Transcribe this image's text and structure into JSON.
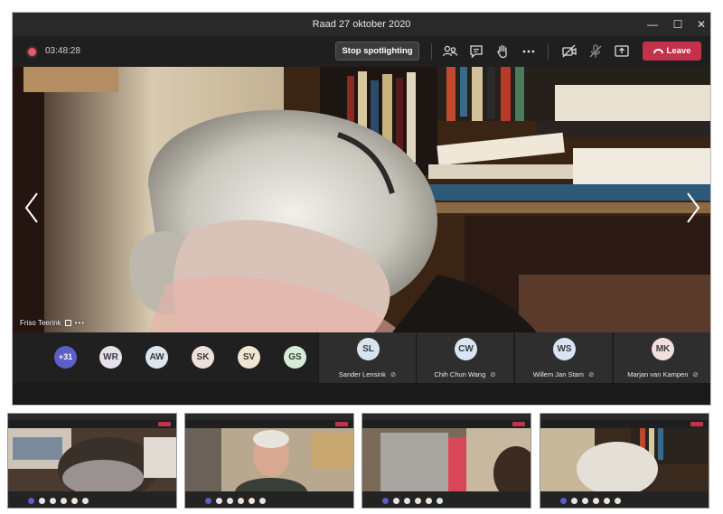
{
  "window": {
    "title": "Raad 27 oktober 2020",
    "minimize_glyph": "—",
    "maximize_glyph": "☐",
    "close_glyph": "✕"
  },
  "toolbar": {
    "timer": "03:48:28",
    "stop_spotlighting_label": "Stop spotlighting",
    "leave_label": "Leave",
    "icons": [
      "participants-icon",
      "chat-icon",
      "raise-hand-icon",
      "more-icon",
      "camera-off-icon",
      "mic-off-icon",
      "share-icon"
    ]
  },
  "spotlight": {
    "speaker_name": "Friso Teerink"
  },
  "participants": {
    "overflow_count": "+31",
    "avatars": [
      {
        "initials": "WR",
        "color": "#e6e1ed"
      },
      {
        "initials": "AW",
        "color": "#dde6ee"
      },
      {
        "initials": "SK",
        "color": "#eee0dc"
      },
      {
        "initials": "SV",
        "color": "#f1e6cf"
      },
      {
        "initials": "GS",
        "color": "#d6ecd8"
      }
    ],
    "tiles": [
      {
        "initials": "SL",
        "name": "Sander Lensink",
        "color": "#d7e4ef"
      },
      {
        "initials": "CW",
        "name": "Chih Chun Wang",
        "color": "#d8e6f3"
      },
      {
        "initials": "WS",
        "name": "Willem Jan Stam",
        "color": "#d9e4f2"
      },
      {
        "initials": "MK",
        "name": "Marjan van Kampen",
        "color": "#f2dede"
      }
    ]
  },
  "colors": {
    "leave": "#c4314b",
    "overflow_avatar": "#5b5fc7",
    "recording": "#e25a6c"
  }
}
